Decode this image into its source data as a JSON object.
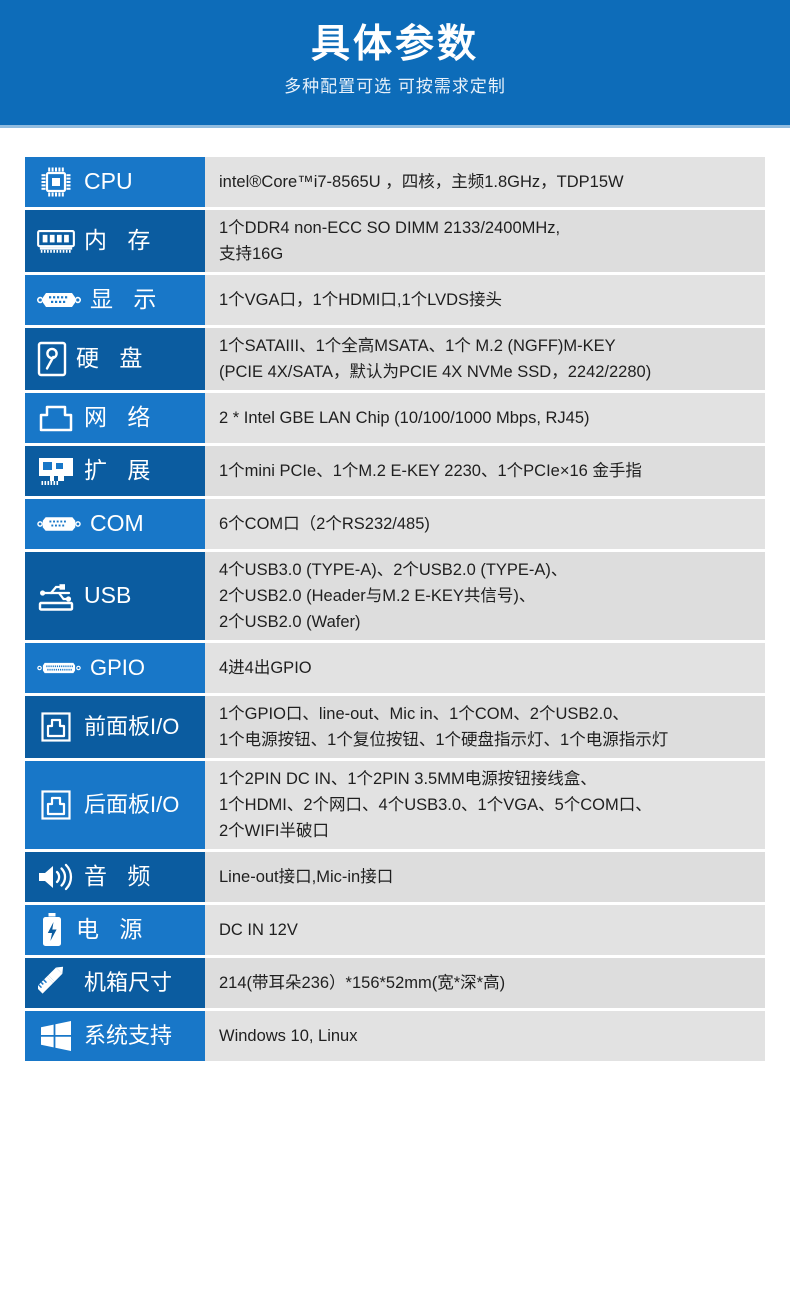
{
  "header": {
    "title": "具体参数",
    "subtitle": "多种配置可选 可按需求定制",
    "bg_color": "#0d6cb9",
    "title_color": "#ffffff"
  },
  "theme": {
    "label_blue_light": "#1877c8",
    "label_blue_dark": "#0b5ca0",
    "value_gray_light": "#e2e2e2",
    "value_gray_dark": "#dddddd",
    "value_text": "#1f1f1f"
  },
  "table": {
    "rows": [
      {
        "icon": "cpu-chip-icon",
        "label": "CPU",
        "lines": [
          "intel®Core™i7-8565U ，四核，主频1.8GHz，TDP15W"
        ]
      },
      {
        "icon": "memory-dimm-icon",
        "label": "内 存",
        "lines": [
          "1个DDR4 non-ECC SO DIMM 2133/2400MHz,",
          "支持16G"
        ]
      },
      {
        "icon": "vga-port-icon",
        "label": "显 示",
        "lines": [
          "1个VGA口，1个HDMI口,1个LVDS接头"
        ]
      },
      {
        "icon": "hard-disk-icon",
        "label": "硬 盘",
        "lines": [
          "1个SATAIII、1个全高MSATA、1个 M.2 (NGFF)M-KEY",
          "(PCIE 4X/SATA，默认为PCIE 4X NVMe SSD，2242/2280)"
        ]
      },
      {
        "icon": "rj45-network-icon",
        "label": "网 络",
        "lines": [
          "2 * Intel GBE LAN Chip (10/100/1000 Mbps, RJ45)"
        ]
      },
      {
        "icon": "expansion-card-icon",
        "label": "扩 展",
        "lines": [
          "1个mini PCIe、1个M.2 E-KEY 2230、1个PCIe×16 金手指"
        ]
      },
      {
        "icon": "db9-serial-port-icon",
        "label": "COM",
        "lines": [
          "6个COM口（2个RS232/485)"
        ]
      },
      {
        "icon": "usb-icon",
        "label": "USB",
        "lines": [
          "4个USB3.0 (TYPE-A)、2个USB2.0 (TYPE-A)、",
          "2个USB2.0 (Header与M.2 E-KEY共信号)、",
          "2个USB2.0 (Wafer)"
        ]
      },
      {
        "icon": "gpio-connector-icon",
        "label": "GPIO",
        "lines": [
          "4进4出GPIO"
        ]
      },
      {
        "icon": "panel-io-icon",
        "label": "前面板I/O",
        "lines": [
          "1个GPIO口、line-out、Mic in、1个COM、2个USB2.0、",
          "1个电源按钮、1个复位按钮、1个硬盘指示灯、1个电源指示灯"
        ]
      },
      {
        "icon": "panel-io-icon",
        "label": "后面板I/O",
        "lines": [
          "1个2PIN DC IN、1个2PIN 3.5MM电源按钮接线盒、",
          "1个HDMI、2个网口、4个USB3.0、1个VGA、5个COM口、",
          "2个WIFI半破口"
        ]
      },
      {
        "icon": "speaker-audio-icon",
        "label": "音 频",
        "lines": [
          "Line-out接口,Mic-in接口"
        ]
      },
      {
        "icon": "battery-power-icon",
        "label": "电 源",
        "lines": [
          "DC IN 12V"
        ]
      },
      {
        "icon": "ruler-pencil-icon",
        "label": "机箱尺寸",
        "lines": [
          "214(带耳朵236）*156*52mm(宽*深*高)"
        ]
      },
      {
        "icon": "windows-logo-icon",
        "label": "系统支持",
        "lines": [
          "Windows 10, Linux"
        ]
      }
    ]
  }
}
